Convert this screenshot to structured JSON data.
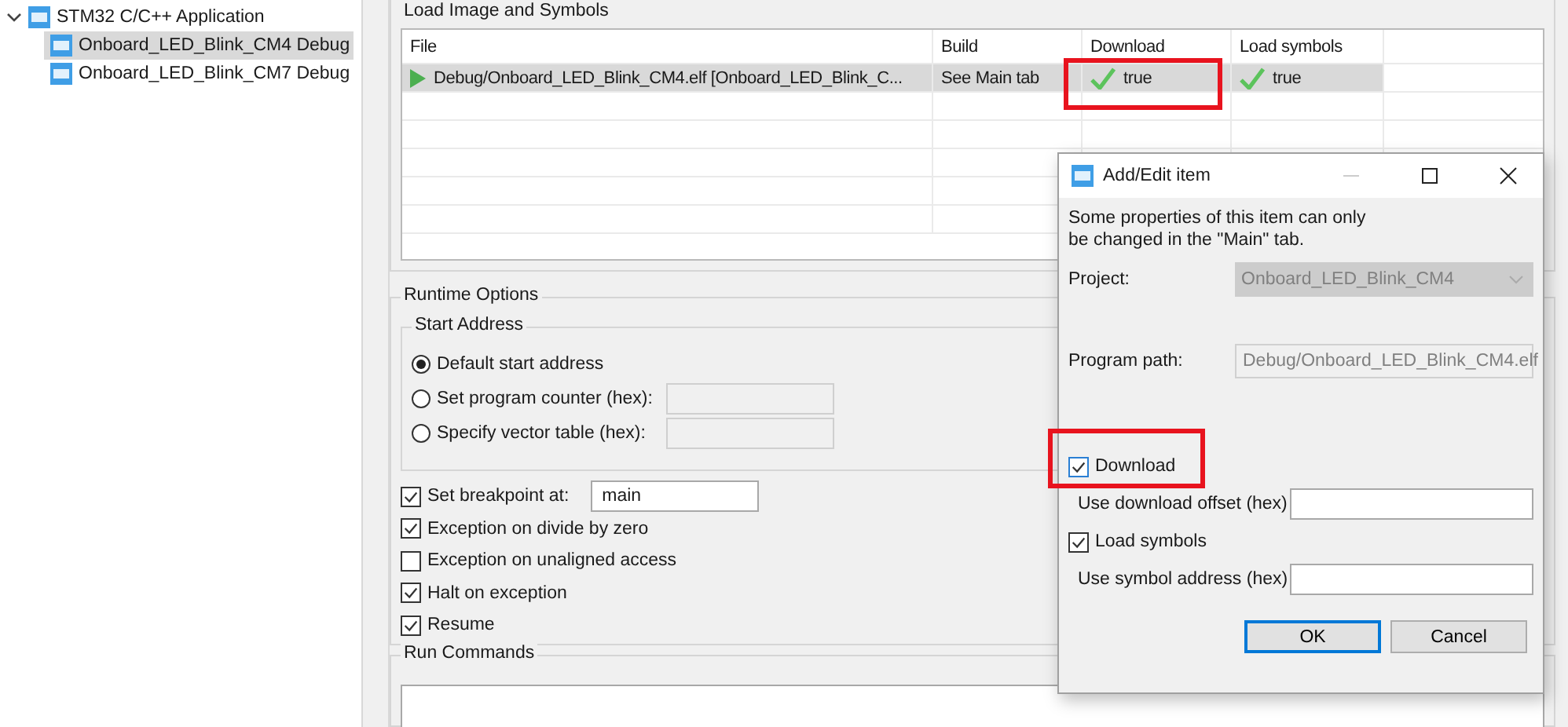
{
  "tree": {
    "label": "STM32 C/C++ Application",
    "expanded": true,
    "children": [
      {
        "label": "Onboard_LED_Blink_CM4 Debug",
        "selected": true
      },
      {
        "label": "Onboard_LED_Blink_CM7 Debug",
        "selected": false
      }
    ]
  },
  "load_group": {
    "title": "Load Image and Symbols",
    "table": {
      "columns": [
        "File",
        "Build",
        "Download",
        "Load symbols"
      ],
      "rows": [
        {
          "file": "Debug/Onboard_LED_Blink_CM4.elf [Onboard_LED_Blink_C...",
          "build": "See Main tab",
          "download": "true",
          "load_symbols": "true",
          "selected": true,
          "download_highlighted": true
        }
      ]
    }
  },
  "runtime_options": {
    "title": "Runtime Options",
    "start_address": {
      "title": "Start Address",
      "options": [
        {
          "label": "Default start address",
          "selected": true,
          "has_field": false
        },
        {
          "label": "Set program counter (hex):",
          "selected": false,
          "has_field": true
        },
        {
          "label": "Specify vector table (hex):",
          "selected": false,
          "has_field": true
        }
      ]
    },
    "checks": [
      {
        "label": "Set breakpoint at:",
        "checked": true,
        "value": "main"
      },
      {
        "label": "Exception on divide by zero",
        "checked": true
      },
      {
        "label": "Exception on unaligned access",
        "checked": false
      },
      {
        "label": "Halt on exception",
        "checked": true
      },
      {
        "label": "Resume",
        "checked": true
      }
    ]
  },
  "run_commands": {
    "title": "Run Commands"
  },
  "dialog": {
    "title": "Add/Edit item",
    "message_lines": [
      "Some properties of this item can only",
      "be changed in the \"Main\" tab."
    ],
    "project": {
      "label": "Project:",
      "value": "Onboard_LED_Blink_CM4",
      "disabled": true
    },
    "program_path": {
      "label": "Program path:",
      "value": "Debug/Onboard_LED_Blink_CM4.elf",
      "disabled": true
    },
    "options": [
      {
        "kind": "checkbox",
        "label": "Download",
        "checked": true,
        "highlighted": true
      },
      {
        "kind": "field",
        "label": "Use download offset (hex)"
      },
      {
        "kind": "checkbox",
        "label": "Load symbols",
        "checked": true,
        "highlighted": false
      },
      {
        "kind": "field",
        "label": "Use symbol address (hex)"
      }
    ],
    "buttons": [
      {
        "label": "OK",
        "default": true
      },
      {
        "label": "Cancel",
        "default": false
      }
    ]
  }
}
